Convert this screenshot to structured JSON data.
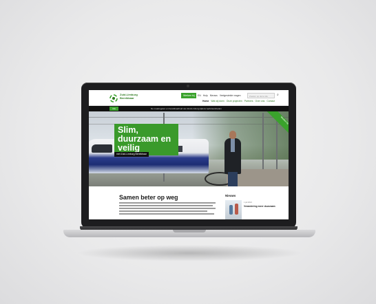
{
  "site": {
    "logo_text_line1": "Zuid-Limburg",
    "logo_text_line2": "Bereikbaar",
    "util_green": "Werken bij",
    "util_links": [
      "EN",
      "Hulp",
      "Nieuws",
      "Veelgestelde vragen"
    ],
    "search_placeholder": "Zoeken op deze site",
    "main_nav": [
      "Home",
      "Wat wij doen",
      "Onze projecten",
      "Partners",
      "Over ons",
      "Contact"
    ],
    "black_bar_label": "Info",
    "black_bar_text": "De maatregelen en bereikbaarheid van Zuid-Limburg tijdens werkzaamheden",
    "hero_title": "Slim, duurzaam en veilig",
    "hero_subtitle": "met Zuid-Limburg Bereikbaar",
    "ribbon_text": "Werken bij ons",
    "section_title": "Samen beter op weg",
    "news_title": "Nieuws",
    "news_date": "1 juli 2021",
    "news_headline": "Verandering meer duurzaam"
  },
  "colors": {
    "brand_green": "#3aa22c",
    "dark_bar": "#111111"
  },
  "icons": {
    "logo": "logo-icon",
    "search": "search-icon"
  }
}
